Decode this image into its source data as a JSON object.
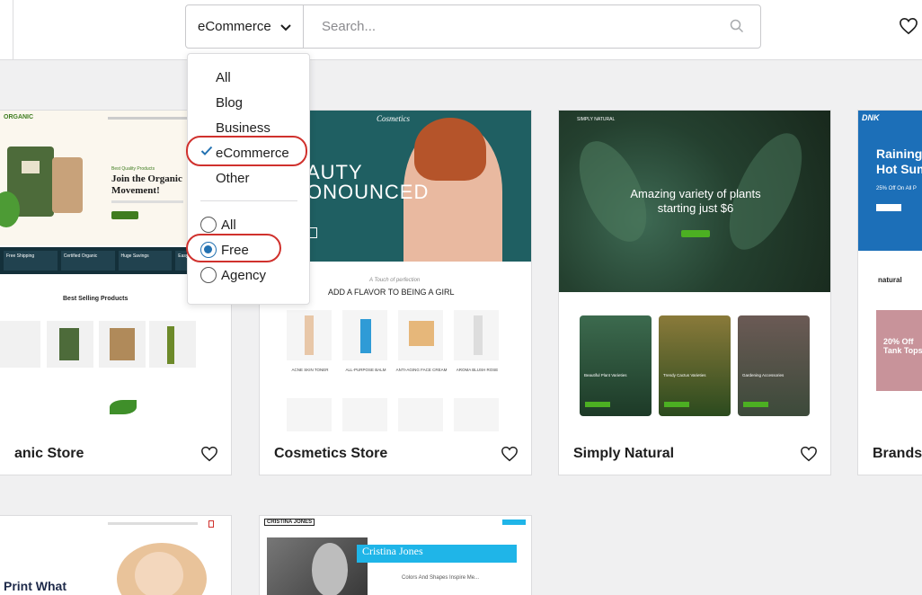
{
  "toolbar": {
    "filter_value": "eCommerce",
    "search_placeholder": "Search..."
  },
  "dropdown": {
    "categories": [
      "All",
      "Blog",
      "Business",
      "eCommerce",
      "Other"
    ],
    "selected_category": "eCommerce",
    "pricing": [
      "All",
      "Free",
      "Agency"
    ],
    "selected_pricing": "Free"
  },
  "cards": [
    {
      "title": "anic Store",
      "preview": {
        "brand": "ORGANIC",
        "eyebrow": "Best Quality Products",
        "headline_1": "Join the Organic",
        "headline_2": "Movement!",
        "features": [
          "Free Shipping",
          "Certified Organic",
          "Huge Savings",
          "Easy Returns"
        ],
        "section": "Best Selling Products"
      }
    },
    {
      "title": "Cosmetics Store",
      "preview": {
        "brand": "Cosmetics",
        "hero_1": "AUTY",
        "hero_2": "ONOUNCED",
        "script": "A Touch of perfection",
        "section": "ADD A FLAVOR TO BEING A GIRL",
        "products": [
          "ACNE SKIN TONER",
          "ALL-PURPOSE BALM",
          "ANTI-AGING FACE CREAM",
          "AROMA BLUSH ROSE"
        ]
      }
    },
    {
      "title": "Simply Natural",
      "preview": {
        "brand": "SIMPLY NATURAL",
        "headline_1": "Amazing variety of plants",
        "headline_2": "starting just $6",
        "tiles": [
          "Beautiful Plant Varieties",
          "Trendy Cactus Varieties",
          "Gardening Accessories"
        ]
      }
    },
    {
      "title": "Brandst",
      "preview": {
        "brand": "DNK",
        "headline_1": "Raining",
        "headline_2": "Hot Sum",
        "offer": "25% Off On All P",
        "brand2": "natural",
        "sale_1": "20% Off",
        "sale_2": "Tank Tops"
      }
    },
    {
      "preview": {
        "headline": "Print What"
      }
    },
    {
      "preview": {
        "logo": "CRISTINA JONES",
        "name": "Cristina Jones",
        "tagline": "Colors And Shapes Inspire Me..."
      }
    }
  ],
  "colors": {
    "accent_blue": "#2271b1",
    "highlight_red": "#d0312d",
    "organic_green": "#3f7d20",
    "cosmetics_teal": "#1f5f62",
    "dnk_blue": "#1c6fb8",
    "cristina_cyan": "#1fb5e8"
  }
}
